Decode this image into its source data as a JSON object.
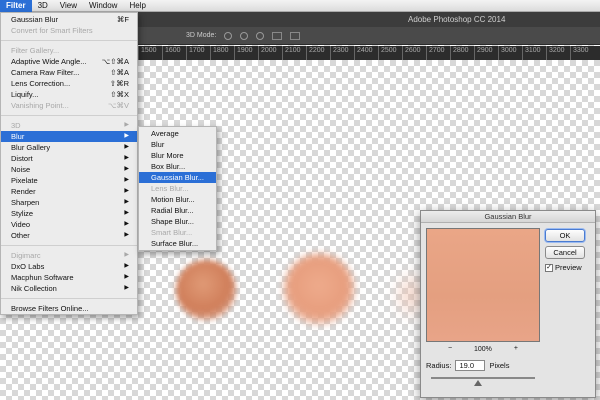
{
  "menubar": {
    "items": [
      "Filter",
      "3D",
      "View",
      "Window",
      "Help"
    ]
  },
  "titlebar": {
    "title": "Adobe Photoshop CC 2014"
  },
  "optionsbar": {
    "mode_label": "3D Mode:"
  },
  "ruler": {
    "ticks": [
      "1500",
      "1600",
      "1700",
      "1800",
      "1900",
      "2000",
      "2100",
      "2200",
      "2300",
      "2400",
      "2500",
      "2600",
      "2700",
      "2800",
      "2900",
      "3000",
      "3100",
      "3200",
      "3300"
    ]
  },
  "filter_menu": {
    "items": [
      {
        "label": "Gaussian Blur",
        "shortcut": "⌘F",
        "disabled": false
      },
      {
        "label": "Convert for Smart Filters",
        "shortcut": "",
        "disabled": true
      },
      {
        "sep": true
      },
      {
        "label": "Filter Gallery...",
        "shortcut": "",
        "disabled": true
      },
      {
        "label": "Adaptive Wide Angle...",
        "shortcut": "⌥⇧⌘A",
        "disabled": false
      },
      {
        "label": "Camera Raw Filter...",
        "shortcut": "⇧⌘A",
        "disabled": false
      },
      {
        "label": "Lens Correction...",
        "shortcut": "⇧⌘R",
        "disabled": false
      },
      {
        "label": "Liquify...",
        "shortcut": "⇧⌘X",
        "disabled": false
      },
      {
        "label": "Vanishing Point...",
        "shortcut": "⌥⌘V",
        "disabled": true
      },
      {
        "sep": true
      },
      {
        "label": "3D",
        "arrow": true,
        "disabled": true
      },
      {
        "label": "Blur",
        "arrow": true,
        "disabled": false,
        "highlight": true
      },
      {
        "label": "Blur Gallery",
        "arrow": true,
        "disabled": false
      },
      {
        "label": "Distort",
        "arrow": true,
        "disabled": false
      },
      {
        "label": "Noise",
        "arrow": true,
        "disabled": false
      },
      {
        "label": "Pixelate",
        "arrow": true,
        "disabled": false
      },
      {
        "label": "Render",
        "arrow": true,
        "disabled": false
      },
      {
        "label": "Sharpen",
        "arrow": true,
        "disabled": false
      },
      {
        "label": "Stylize",
        "arrow": true,
        "disabled": false
      },
      {
        "label": "Video",
        "arrow": true,
        "disabled": false
      },
      {
        "label": "Other",
        "arrow": true,
        "disabled": false
      },
      {
        "sep": true
      },
      {
        "label": "Digimarc",
        "arrow": true,
        "disabled": true
      },
      {
        "label": "DxO Labs",
        "arrow": true,
        "disabled": false
      },
      {
        "label": "Macphun Software",
        "arrow": true,
        "disabled": false
      },
      {
        "label": "Nik Collection",
        "arrow": true,
        "disabled": false
      },
      {
        "sep": true
      },
      {
        "label": "Browse Filters Online...",
        "shortcut": "",
        "disabled": false
      }
    ]
  },
  "blur_submenu": {
    "items": [
      {
        "label": "Average",
        "disabled": false
      },
      {
        "label": "Blur",
        "disabled": false
      },
      {
        "label": "Blur More",
        "disabled": false
      },
      {
        "label": "Box Blur...",
        "disabled": false
      },
      {
        "label": "Gaussian Blur...",
        "disabled": false,
        "highlight": true
      },
      {
        "label": "Lens Blur...",
        "disabled": true
      },
      {
        "label": "Motion Blur...",
        "disabled": false
      },
      {
        "label": "Radial Blur...",
        "disabled": false
      },
      {
        "label": "Shape Blur...",
        "disabled": false
      },
      {
        "label": "Smart Blur...",
        "disabled": true
      },
      {
        "label": "Surface Blur...",
        "disabled": false
      }
    ]
  },
  "dialog": {
    "title": "Gaussian Blur",
    "ok_label": "OK",
    "cancel_label": "Cancel",
    "preview_label": "Preview",
    "preview_checked": "✓",
    "zoom_out": "−",
    "zoom_in": "+",
    "zoom_value": "100%",
    "radius_label": "Radius:",
    "radius_value": "19.0",
    "radius_unit": "Pixels",
    "radius_slider_fraction": 0.45
  },
  "colors": {
    "menu_highlight": "#2b6fd6",
    "preview_fill": "#e6a284"
  }
}
